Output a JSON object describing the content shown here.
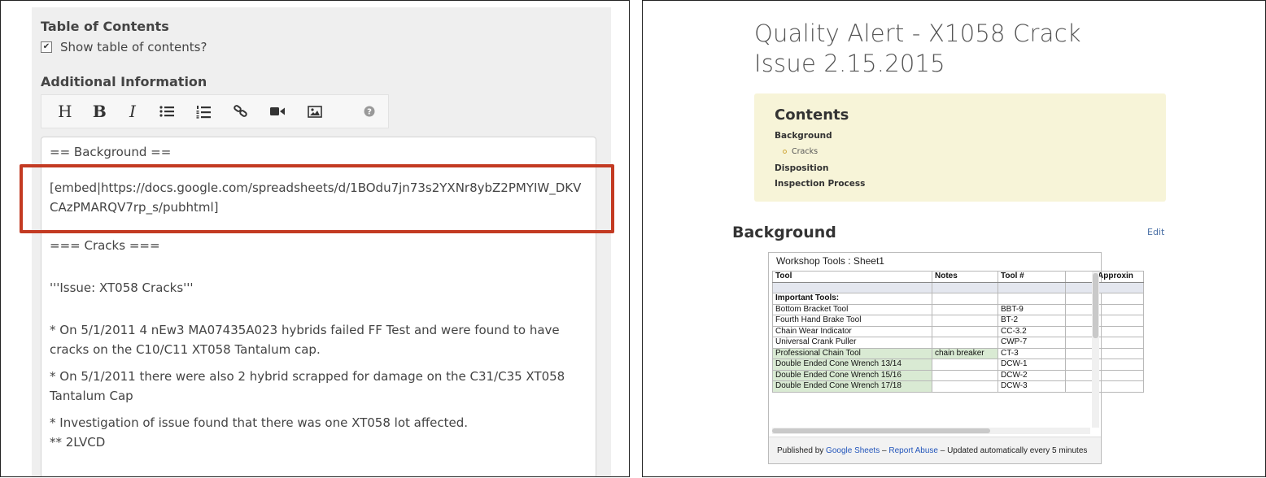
{
  "editor": {
    "toc_heading": "Table of Contents",
    "toc_checkbox_label": "Show table of contents?",
    "toc_checkbox_checked": true,
    "additional_heading": "Additional Information",
    "toolbar": {
      "heading_label": "H",
      "bold_label": "B",
      "italic_label": "I",
      "icons": [
        "bullet-list-icon",
        "numbered-list-icon",
        "link-icon",
        "video-icon",
        "image-icon",
        "help-icon"
      ]
    },
    "lines": [
      "== Background ==",
      "[embed|https://docs.google.com/spreadsheets/d/1BOdu7jn73s2YXNr8ybZ2PMYIW_DKV",
      "CAzPMARQV7rp_s/pubhtml]",
      "=== Cracks ===",
      "'''Issue: XT058 Cracks'''",
      "* On 5/1/2011 4 nEw3 MA07435A023 hybrids failed FF Test and were found to have",
      "cracks on the C10/C11 XT058 Tantalum cap.",
      "* On 5/1/2011 there were also 2 hybrid scrapped for damage on the C31/C35 XT058",
      "Tantalum Cap",
      "* Investigation of issue found that there was one XT058 lot affected.",
      "** 2LVCD"
    ]
  },
  "preview": {
    "title": "Quality Alert - X1058 Crack Issue 2.15.2015",
    "toc": {
      "title": "Contents",
      "items": [
        "Background",
        "Cracks",
        "Disposition",
        "Inspection Process"
      ]
    },
    "section_heading": "Background",
    "edit_label": "Edit",
    "sheet": {
      "title": "Workshop Tools : Sheet1",
      "headers": [
        "Tool",
        "Notes",
        "Tool #",
        "",
        "Approxin"
      ],
      "rows": [
        [
          "Important Tools:",
          "",
          "",
          "",
          ""
        ],
        [
          "Bottom Bracket Tool",
          "",
          "BBT-9",
          "",
          ""
        ],
        [
          "Fourth Hand Brake Tool",
          "",
          "BT-2",
          "",
          ""
        ],
        [
          "Chain Wear Indicator",
          "",
          "CC-3.2",
          "",
          ""
        ],
        [
          "Universal Crank Puller",
          "",
          "CWP-7",
          "",
          ""
        ],
        [
          "Professional Chain Tool",
          "chain breaker",
          "CT-3",
          "",
          ""
        ],
        [
          "Double Ended Cone Wrench 13/14",
          "",
          "DCW-1",
          "",
          ""
        ],
        [
          "Double Ended Cone Wrench 15/16",
          "",
          "DCW-2",
          "",
          ""
        ],
        [
          "Double Ended Cone Wrench 17/18",
          "",
          "DCW-3",
          "",
          ""
        ]
      ],
      "footer": {
        "published_by": "Published by",
        "google_sheets": "Google Sheets",
        "dash1": "–",
        "report_abuse": "Report Abuse",
        "updated": "– Updated automatically every 5 minutes"
      }
    }
  },
  "colors": {
    "highlight_border": "#c33a22",
    "toc_background": "#f7f4d8",
    "green_cells": "#d9ead3",
    "link": "#2255bb"
  }
}
